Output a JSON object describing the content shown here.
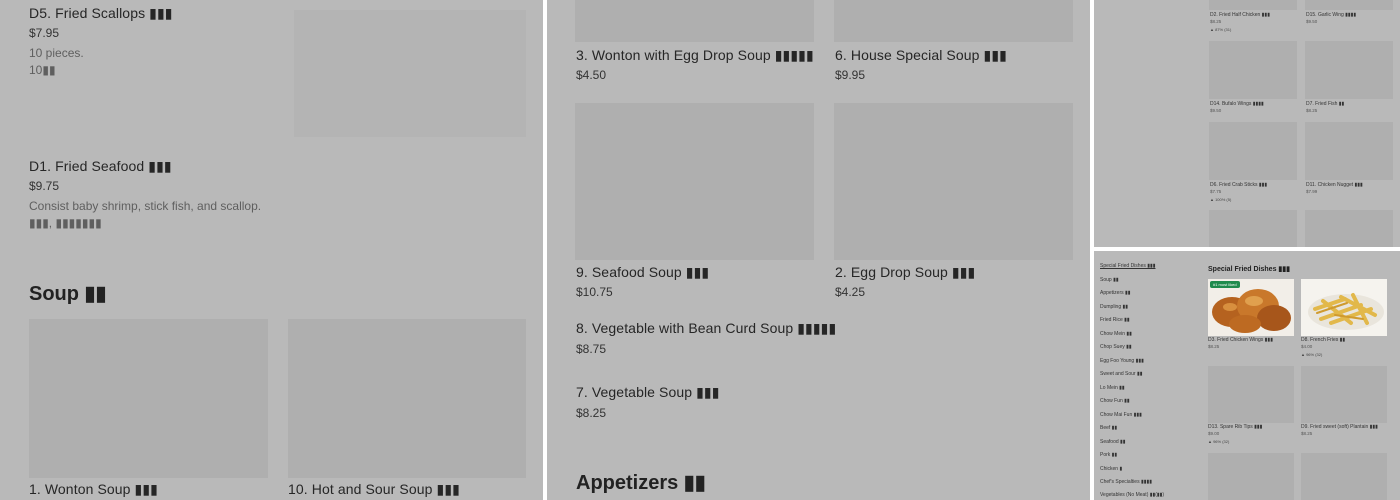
{
  "panel1": {
    "items": [
      {
        "name": "D5. Fried Scallops ▮▮▮",
        "price": "$7.95",
        "desc": "10 pieces.",
        "desc2": "10▮▮"
      },
      {
        "name": "D1. Fried Seafood ▮▮▮",
        "price": "$9.75",
        "desc": "Consist baby shrimp, stick fish, and scallop.",
        "desc2": "▮▮▮, ▮▮▮▮▮▮▮"
      }
    ],
    "section": "Soup ▮▮",
    "soups": [
      {
        "name": "1. Wonton Soup ▮▮▮"
      },
      {
        "name": "10. Hot and Sour Soup ▮▮▮"
      }
    ]
  },
  "panel2": {
    "items": [
      {
        "name": "3. Wonton with Egg Drop Soup ▮▮▮▮▮",
        "price": "$4.50"
      },
      {
        "name": "6. House Special Soup ▮▮▮",
        "price": "$9.95"
      },
      {
        "name": "9. Seafood Soup ▮▮▮",
        "price": "$10.75"
      },
      {
        "name": "2. Egg Drop Soup ▮▮▮",
        "price": "$4.25"
      },
      {
        "name": "8. Vegetable with Bean Curd Soup ▮▮▮▮▮",
        "price": "$8.75"
      },
      {
        "name": "7. Vegetable Soup ▮▮▮",
        "price": "$8.25"
      }
    ],
    "section": "Appetizers ▮▮"
  },
  "panel3": {
    "items": [
      {
        "name": "D2. Fried Half Chicken ▮▮▮",
        "price": "$8.25",
        "badge": "▲ 87% (31)"
      },
      {
        "name": "D15. Garlic Wing ▮▮▮▮",
        "price": "$9.50",
        "badge": ""
      },
      {
        "name": "D14. Bufalo Wings ▮▮▮▮",
        "price": "$9.50",
        "badge": ""
      },
      {
        "name": "D7. Fried Fish ▮▮",
        "price": "$8.25",
        "badge": ""
      },
      {
        "name": "D6. Fried Crab Sticks ▮▮▮",
        "price": "$7.75",
        "badge": "▲ 100% (5)"
      },
      {
        "name": "D11. Chicken Nugget ▮▮▮",
        "price": "$7.99",
        "badge": ""
      }
    ]
  },
  "panel4": {
    "sidebar": [
      "Special Fried Dishes ▮▮▮",
      "Soup ▮▮",
      "Appetizers ▮▮",
      "Dumpling ▮▮",
      "Fried Rice ▮▮",
      "Chow Mein ▮▮",
      "Chop Suey ▮▮",
      "Egg Foo Young ▮▮▮",
      "Sweet and Sour ▮▮",
      "Lo Mein ▮▮",
      "Chow Fun ▮▮",
      "Chow Mai Fun ▮▮▮",
      "Beef ▮▮",
      "Seafood ▮▮",
      "Pork ▮▮",
      "Chicken ▮",
      "Chef's Specialties ▮▮▮▮",
      "Vegetables (No Meat) ▮▮(▮▮)"
    ],
    "section": "Special Fried Dishes ▮▮▮",
    "green_badge": "#1 most liked",
    "items": [
      {
        "name": "D3. Fried Chicken Wings ▮▮▮",
        "price": "$8.25",
        "badge": ""
      },
      {
        "name": "D8. French Fries ▮▮",
        "price": "$4.00",
        "badge": "▲ 96% (32)"
      },
      {
        "name": "D13. Spare Rib Tips ▮▮▮",
        "price": "$9.00",
        "badge": "▲ 96% (32)"
      },
      {
        "name": "D9. Fried sweet (soft) Plantain ▮▮▮",
        "price": "$8.25",
        "badge": ""
      }
    ]
  },
  "colors": {
    "overlay": "#b9b9b9",
    "placeholder": "#afafaf",
    "accent_green": "#1f8a4c"
  }
}
